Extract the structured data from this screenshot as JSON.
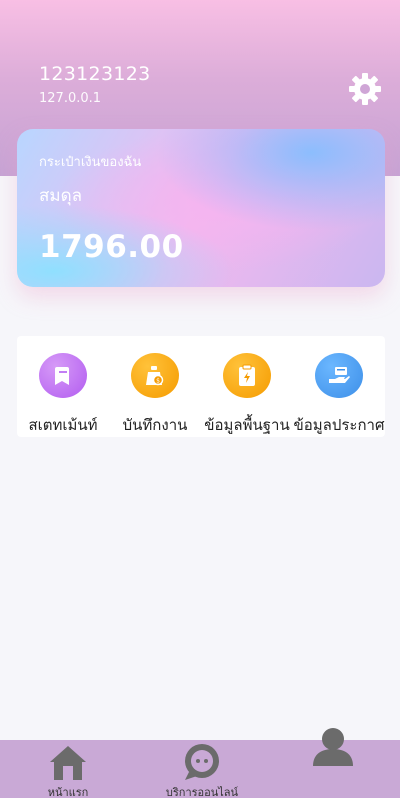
{
  "account": {
    "username": "123123123",
    "ip": "127.0.0.1"
  },
  "wallet": {
    "title": "กระเป๋าเงินของฉัน",
    "balance_label": "สมดุล",
    "amount": "1796.00"
  },
  "menu": {
    "items": [
      {
        "label": "สเตทเม้นท์",
        "icon": "document-icon",
        "color": "#b25cf0"
      },
      {
        "label": "บันทึกงาน",
        "icon": "money-bag-icon",
        "color": "#f59b00"
      },
      {
        "label": "ข้อมูลพื้นฐาน",
        "icon": "clipboard-lightning-icon",
        "color": "#f59b00"
      },
      {
        "label": "ข้อมูลประกาศ",
        "icon": "hand-card-icon",
        "color": "#3d8fe8"
      }
    ]
  },
  "tabbar": {
    "items": [
      {
        "label": "หน้าแรก",
        "icon": "home-icon"
      },
      {
        "label": "บริการออนไลน์",
        "icon": "chat-bubble-icon"
      },
      {
        "label": "",
        "icon": "person-icon"
      }
    ]
  },
  "colors": {
    "header_top": "#f8bfe4",
    "header_bottom": "#c6a3d4",
    "tabbar": "#c9a9d6",
    "tab_icon": "#6b6b6b"
  }
}
